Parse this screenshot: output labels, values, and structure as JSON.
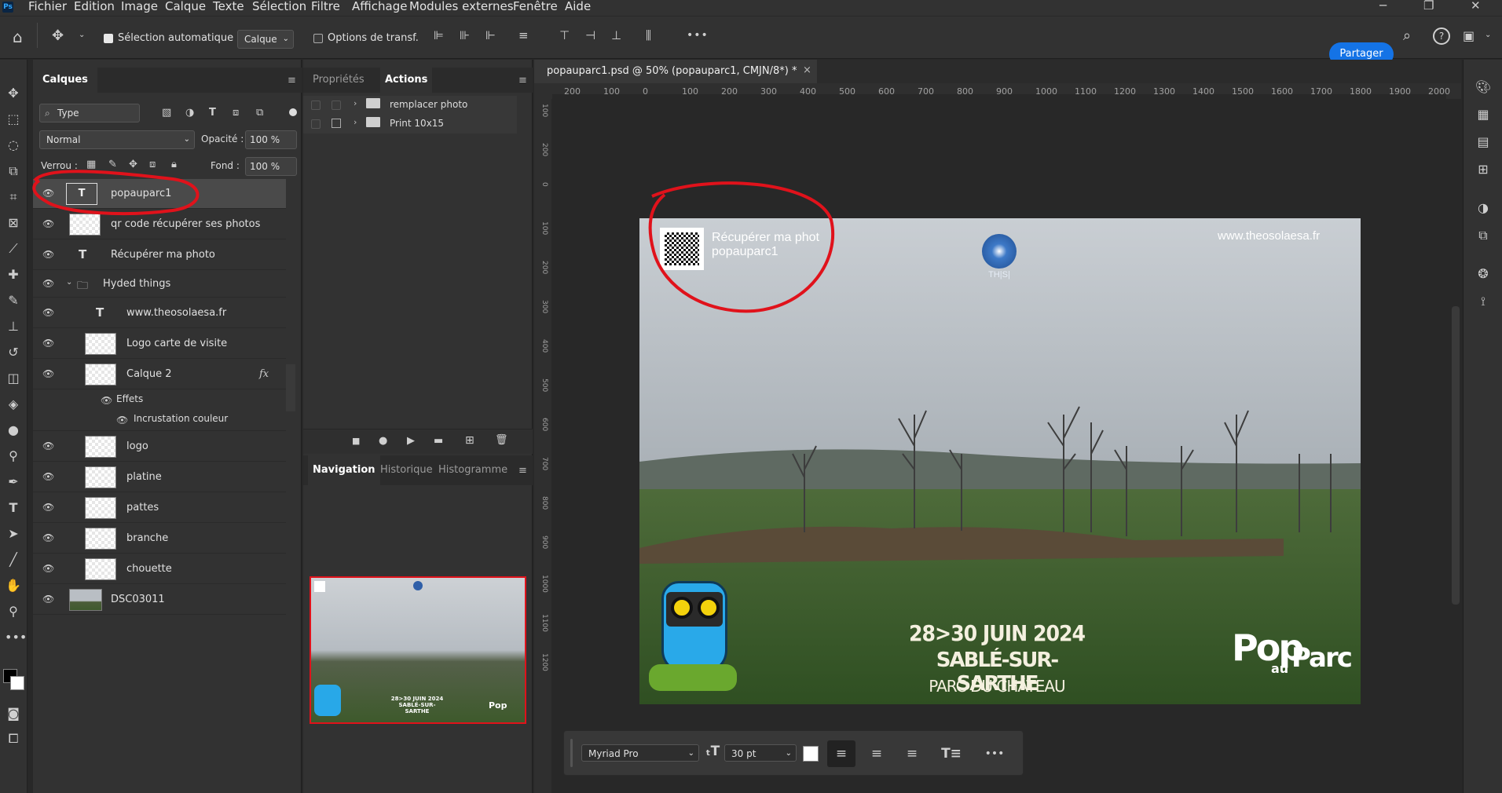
{
  "app": {
    "logo": "Ps"
  },
  "menu": [
    "Fichier",
    "Edition",
    "Image",
    "Calque",
    "Texte",
    "Sélection",
    "Filtre",
    "Affichage",
    "Modules externes",
    "Fenêtre",
    "Aide"
  ],
  "options": {
    "auto_select_label": "Sélection automatique :",
    "auto_select_value": "Calque",
    "transform_label": "Options de transf.",
    "more": "•••",
    "share": "Partager"
  },
  "layers_panel": {
    "tab": "Calques",
    "filter_value": "Type",
    "blend_mode": "Normal",
    "opacity_label": "Opacité :",
    "opacity_value": "100 %",
    "lock_label": "Verrou :",
    "fill_label": "Fond :",
    "fill_value": "100 %",
    "layers": [
      {
        "name": "popauparc1",
        "kind": "text"
      },
      {
        "name": "qr code récupérer ses photos",
        "kind": "smart"
      },
      {
        "name": "Récupérer ma photo",
        "kind": "text"
      },
      {
        "name": "Hyded things",
        "kind": "group"
      },
      {
        "name": "www.theosolaesa.fr",
        "kind": "text"
      },
      {
        "name": "Logo carte de visite",
        "kind": "smart"
      },
      {
        "name": "Calque 2",
        "kind": "fx"
      },
      {
        "name": "Effets",
        "kind": "effects"
      },
      {
        "name": "Incrustation couleur",
        "kind": "effect"
      },
      {
        "name": "logo",
        "kind": "pixel"
      },
      {
        "name": "platine",
        "kind": "pixel"
      },
      {
        "name": "pattes",
        "kind": "pixel"
      },
      {
        "name": "branche",
        "kind": "pixel"
      },
      {
        "name": "chouette",
        "kind": "pixel"
      },
      {
        "name": "DSC03011",
        "kind": "photo"
      }
    ],
    "fx_label": "fx"
  },
  "actions_panel": {
    "tabs": [
      "Propriétés",
      "Actions"
    ],
    "items": [
      "remplacer photo",
      "Print 10x15"
    ]
  },
  "nav_panel": {
    "tabs": [
      "Navigation",
      "Historique",
      "Histogramme"
    ]
  },
  "document": {
    "tab_title": "popauparc1.psd @ 50% (popauparc1, CMJN/8*) *",
    "close": "×",
    "ruler_h": [
      "200",
      "100",
      "0",
      "100",
      "200",
      "300",
      "400",
      "500",
      "600",
      "700",
      "800",
      "900",
      "1000",
      "1100",
      "1200",
      "1300",
      "1400",
      "1500",
      "1600",
      "1700",
      "1800",
      "1900",
      "2000"
    ],
    "ruler_v": [
      "100",
      "200",
      "0",
      "100",
      "200",
      "300",
      "400",
      "500",
      "600",
      "700",
      "800",
      "900",
      "1000",
      "1100",
      "1200"
    ],
    "qr_text_1": "Récupérer ma phot",
    "qr_text_2": "popauparc1",
    "logo_text": "TH|S|",
    "website": "www.theosolaesa.fr",
    "date_line": "28>30 JUIN 2024",
    "city_line": "SABLÉ-SUR-SARTHE",
    "place_line": "PARC DU CHÂTEAU",
    "brand_pop": "Pop",
    "brand_au": "au",
    "brand_parc": "Parc"
  },
  "text_toolbar": {
    "font": "Myriad Pro",
    "size": "30 pt",
    "more": "•••"
  },
  "colors": {
    "accent": "#1473e6",
    "annotation": "#e0121b"
  }
}
